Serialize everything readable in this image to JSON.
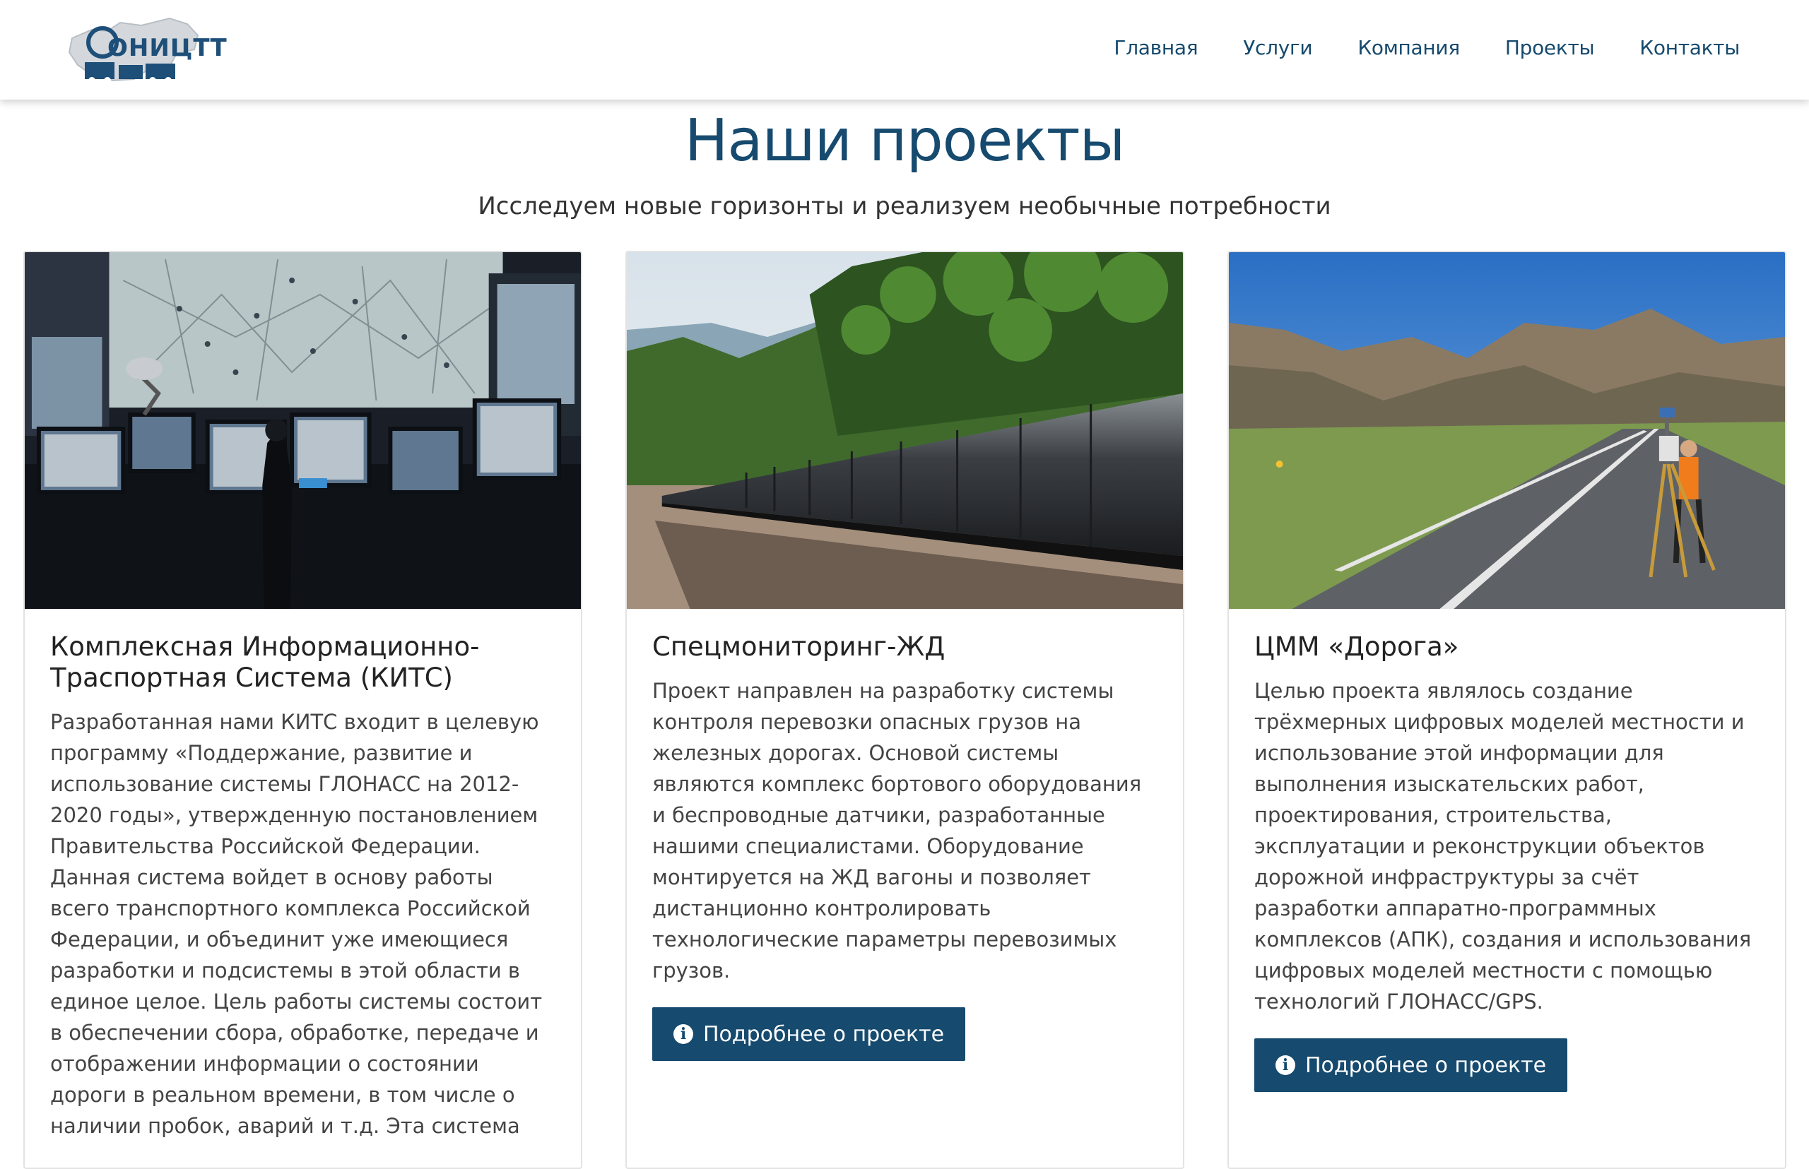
{
  "header": {
    "logo_text": "ОНИЦТТ",
    "nav": [
      {
        "label": "Главная"
      },
      {
        "label": "Услуги"
      },
      {
        "label": "Компания"
      },
      {
        "label": "Проекты"
      },
      {
        "label": "Контакты"
      }
    ]
  },
  "page": {
    "title": "Наши проекты",
    "subtitle": "Исследуем новые горизонты и реализуем необычные потребности"
  },
  "projects": [
    {
      "title": "Комплексная Информационно-Траспортная Система (КИТС)",
      "description": "Разработанная нами КИТС входит в целевую программу «Поддержание, развитие и использование системы ГЛОНАСС на 2012-2020 годы», утвержденную постановлением Правительства Российской Федерации. Данная система войдет в основу работы всего транспортного комплекса Российской Федерации, и объединит уже имеющиеся разработки и подсистемы в этой области в единое целое. Цель работы системы состоит в обеспечении сбора, обработке, передаче и отображении информации о состоянии дороги в реальном времени, в том числе о наличии пробок, аварий и т.д. Эта система",
      "image": "control-room-photo",
      "button": null
    },
    {
      "title": "Спецмониторинг-ЖД",
      "description": "Проект направлен на разработку системы контроля перевозки опасных грузов на железных дорогах. Основой системы являются комплекс бортового оборудования и беспроводные датчики, разработанные нашими специалистами. Оборудование монтируется на ЖД вагоны и позволяет дистанционно контролировать технологические параметры перевозимых грузов.",
      "image": "tank-train-photo",
      "button": "Подробнее о проекте"
    },
    {
      "title": "ЦММ «Дорога»",
      "description": "Целью проекта являлось создание трёхмерных цифровых моделей местности и использование этой информации для выполнения изыскательских работ, проектирования, строительства, эксплуатации и реконструкции объектов дорожной инфраструктуры за счёт разработки аппаратно-программных комплексов (АПК), создания и использования цифровых моделей местности с помощью технологий ГЛОНАСС/GPS.",
      "image": "road-survey-photo",
      "button": "Подробнее о проекте"
    }
  ],
  "colors": {
    "brand": "#164a6e",
    "button": "#164a6e"
  },
  "icons": {
    "button_icon": "info-circle-icon"
  }
}
